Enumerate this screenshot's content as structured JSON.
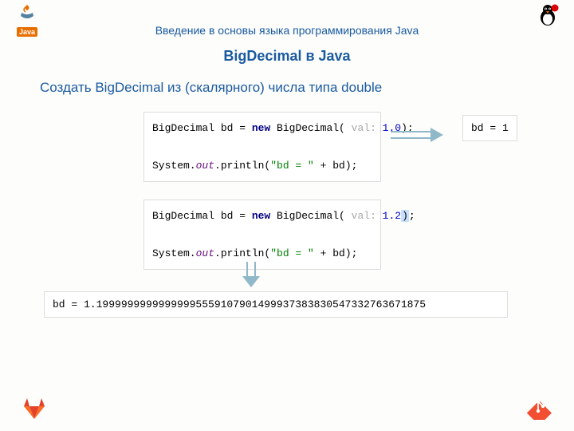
{
  "logo": {
    "brand": "Java"
  },
  "header": {
    "subtitle": "Введение в основы языка программирования Java",
    "title": "BigDecimal в Java"
  },
  "section_title": "Создать BigDecimal из (скалярного) числа типа double",
  "code1": {
    "line1_pre": "BigDecimal bd = ",
    "line1_kw": "new",
    "line1_cls": " BigDecimal(",
    "line1_hint": " val: ",
    "line1_num": "1.0",
    "line1_post": ");",
    "line2_pre": "System.",
    "line2_stat": "out",
    "line2_mid": ".println(",
    "line2_str": "\"bd = \"",
    "line2_post": " + bd);"
  },
  "code2": {
    "line1_pre": "BigDecimal bd = ",
    "line1_kw": "new",
    "line1_cls": " BigDecimal(",
    "line1_hint": " val: ",
    "line1_num": "1.2",
    "line1_post": ");",
    "line2_pre": "System.",
    "line2_stat": "out",
    "line2_mid": ".println(",
    "line2_str": "\"bd = \"",
    "line2_post": " + bd);"
  },
  "output1": "bd = 1",
  "output2": "bd = 1.19999999999999995559107901499937383830547332763671875"
}
